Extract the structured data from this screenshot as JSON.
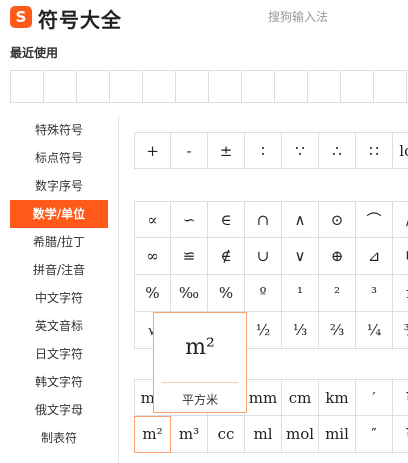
{
  "header": {
    "logo_letter": "S",
    "title": "符号大全",
    "brand": "搜狗输入法"
  },
  "recent": {
    "label": "最近使用",
    "cells": 12
  },
  "sidebar": {
    "items": [
      {
        "label": "特殊符号"
      },
      {
        "label": "标点符号"
      },
      {
        "label": "数字序号"
      },
      {
        "label": "数学/单位",
        "active": true
      },
      {
        "label": "希腊/拉丁"
      },
      {
        "label": "拼音/注音"
      },
      {
        "label": "中文字符"
      },
      {
        "label": "英文音标"
      },
      {
        "label": "日文字符"
      },
      {
        "label": "韩文字符"
      },
      {
        "label": "俄文字母"
      },
      {
        "label": "制表符"
      }
    ]
  },
  "grid_top": {
    "rows": [
      [
        "+",
        "-",
        "±",
        "∶",
        "∵",
        "∴",
        "∷",
        "log"
      ]
    ]
  },
  "grid_main": {
    "rows": [
      [
        "∝",
        "∽",
        "∈",
        "∩",
        "∧",
        "⊙",
        "⌒",
        "//"
      ],
      [
        "∞",
        "≌",
        "∉",
        "∪",
        "∨",
        "⊕",
        "⊿",
        "∟"
      ],
      [
        "%",
        "‰",
        "%",
        "º",
        "¹",
        "²",
        "³",
        "n"
      ],
      [
        "√",
        "",
        "",
        "½",
        "⅓",
        "⅔",
        "¼",
        "¾"
      ]
    ]
  },
  "grid_units": {
    "rows": [
      [
        "mg",
        "",
        "",
        "mm",
        "cm",
        "km",
        "′",
        "¥"
      ],
      [
        "m²",
        "m³",
        "cc",
        "ml",
        "mol",
        "mil",
        "″",
        "¥"
      ]
    ]
  },
  "popup": {
    "symbol": "m²",
    "name": "平方米"
  }
}
